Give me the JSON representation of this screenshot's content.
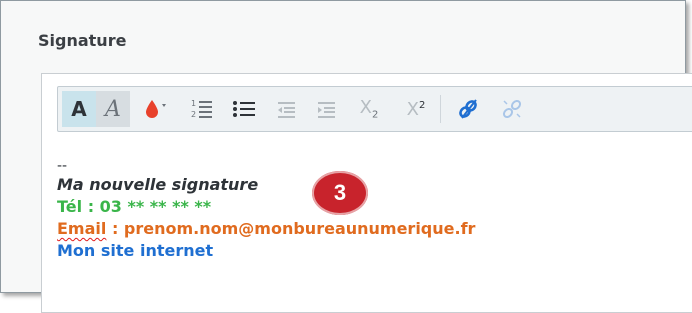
{
  "panel": {
    "title": "Signature"
  },
  "toolbar": {
    "buttons": [
      {
        "id": "bold",
        "label": "A",
        "icon": "text-color-bold-icon"
      },
      {
        "id": "italic",
        "label": "A",
        "icon": "text-style-italic-icon"
      },
      {
        "id": "color",
        "icon": "ink-drop-color-icon"
      },
      {
        "id": "ordered-list",
        "icon": "ordered-list-icon"
      },
      {
        "id": "unordered-list",
        "icon": "unordered-list-icon"
      },
      {
        "id": "outdent",
        "icon": "outdent-icon"
      },
      {
        "id": "indent",
        "icon": "indent-icon"
      },
      {
        "id": "subscript",
        "label": "X",
        "sub": "2",
        "icon": "subscript-icon"
      },
      {
        "id": "superscript",
        "label": "X",
        "sup": "2",
        "icon": "superscript-icon"
      },
      {
        "id": "link",
        "icon": "link-icon"
      },
      {
        "id": "unlink",
        "icon": "unlink-icon"
      }
    ]
  },
  "signature": {
    "separator": "--",
    "name": "Ma nouvelle signature",
    "tel_prefix": "Tél : 03 ",
    "tel_masked": "** ** ** **",
    "email_label": "Email",
    "email_rest": " : prenom.nom@monbureaunumerique.fr",
    "site": "Mon site internet"
  },
  "badge": {
    "number": "3"
  },
  "colors": {
    "accent_bg": "#c9e3ec",
    "tel": "#3ab54a",
    "email": "#e06b1f",
    "site": "#1f6fd1",
    "badge": "#c8232c"
  }
}
